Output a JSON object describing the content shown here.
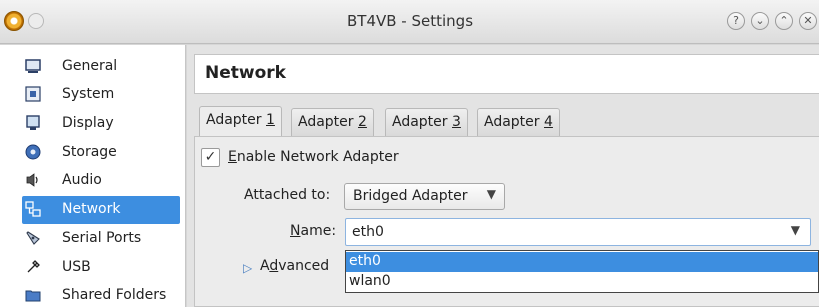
{
  "window": {
    "title": "BT4VB - Settings",
    "buttons": {
      "help": "?",
      "minimize": "⌄",
      "maximize": "⌃",
      "close": "✕"
    }
  },
  "sidebar": {
    "items": [
      {
        "label": "General",
        "icon": "monitor-icon"
      },
      {
        "label": "System",
        "icon": "chip-icon"
      },
      {
        "label": "Display",
        "icon": "display-icon"
      },
      {
        "label": "Storage",
        "icon": "disk-icon"
      },
      {
        "label": "Audio",
        "icon": "speaker-icon"
      },
      {
        "label": "Network",
        "icon": "network-icon",
        "selected": true
      },
      {
        "label": "Serial Ports",
        "icon": "serial-icon"
      },
      {
        "label": "USB",
        "icon": "usb-icon"
      },
      {
        "label": "Shared Folders",
        "icon": "folder-icon"
      }
    ]
  },
  "main": {
    "section_title": "Network",
    "tabs": [
      {
        "prefix": "Adapter ",
        "accel": "1",
        "active": true
      },
      {
        "prefix": "Adapter ",
        "accel": "2"
      },
      {
        "prefix": "Adapter ",
        "accel": "3"
      },
      {
        "prefix": "Adapter ",
        "accel": "4"
      }
    ],
    "enable_adapter": {
      "accel": "E",
      "rest": "nable Network Adapter",
      "checked": true,
      "mark": "✓"
    },
    "attached_to": {
      "label": "Attached to:",
      "value": "Bridged Adapter"
    },
    "name": {
      "accel": "N",
      "rest": "ame:",
      "value": "eth0"
    },
    "advanced": {
      "prefix": "A",
      "accel": "d",
      "rest": "vanced"
    },
    "name_options": [
      "eth0",
      "wlan0"
    ],
    "selected_option": "eth0"
  },
  "colors": {
    "selection": "#3d8ee0"
  }
}
